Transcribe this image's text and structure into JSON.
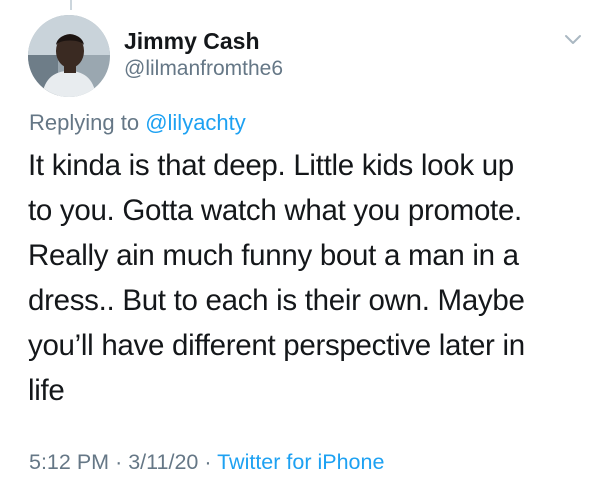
{
  "author": {
    "display_name": "Jimmy Cash",
    "handle": "@lilmanfromthe6"
  },
  "reply": {
    "prefix": "Replying to",
    "mention": "@lilyachty"
  },
  "tweet": {
    "lines": [
      "It kinda is that deep. Little kids look up",
      "to you. Gotta watch what you promote.",
      "Really ain much funny bout a man in a",
      "dress.. But to each is their own. Maybe",
      "you’ll have different perspective later in",
      "life"
    ]
  },
  "meta": {
    "time": "5:12 PM",
    "separator": "·",
    "date": "3/11/20",
    "source": "Twitter for iPhone"
  },
  "icons": {
    "menu": "chevron-down-icon"
  },
  "colors": {
    "text": "#14171a",
    "secondary": "#657786",
    "link": "#1da1f2"
  }
}
